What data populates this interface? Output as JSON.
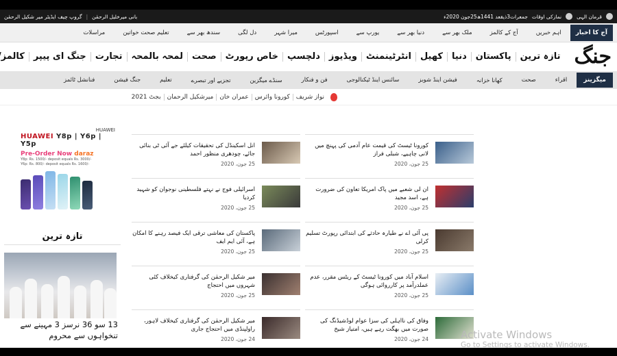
{
  "topbar": {
    "right": [
      "قرمان الہی",
      "نمازکی اوقات",
      "جمعرات3ذیقعد 1441ھ25جون 2020ء"
    ],
    "left": [
      "بانی میرخلیل الرحمٰن",
      "گروپ چیف ایڈیٹر میر شکیل الرحمٰن"
    ]
  },
  "secnav": {
    "active": "آج کا اخبار",
    "items": [
      "اہم خبریں",
      "آج کے کالمز",
      "ملک بھر سے",
      "دنیا بھر سے",
      "یورپ سے",
      "اسپورٹس",
      "میرا شہر",
      "دل لگی",
      "سندھ بھر سے",
      "تعلیم صحت خواتین",
      "مراسلات"
    ]
  },
  "logo": "جنگ",
  "mainnav": [
    "تازہ ترین",
    "پاکستان",
    "دنیا",
    "کھیل",
    "انٹرٹینمنٹ",
    "ویڈیوز",
    "دلچسپ",
    "خاص رپورٹ",
    "صحت",
    "لمحہ بالمحہ",
    "تجارت",
    "جنگ ای پیپر",
    "کالمز/کالم"
  ],
  "magbar": {
    "active": "میگزینز",
    "items": [
      "اقراء",
      "صحت",
      "کھانا خزانہ",
      "فیشن اینڈ شوبز",
      "سائنس اینڈ ٹیکنالوجی",
      "فن و فنکار",
      "سنڈے میگزین",
      "تجزیے اور تبصرے",
      "تعلیم",
      "جنگ فیشن",
      "فنانشل ٹائمز"
    ]
  },
  "trending": [
    "نواز شریف",
    "کورونا وائرس",
    "عمران خان",
    "میرشکیل الرحمان",
    "بجٹ 2021"
  ],
  "ad": {
    "brand": "HUAWEI",
    "model_prefix": "HUAWEI ",
    "model": "Y8p | Y6p | Y5p",
    "preorder": "Pre-Order Now",
    "store": "daraz",
    "line1": "Y8p: Rs. 1500/- deposit equals Rs. 3000/-",
    "line2": "Y6p: Rs. 800/- deposit equals Rs. 1600/-"
  },
  "latest": {
    "heading": "تازہ ترین",
    "title": "13 سو 36 نرسز 3 مہینے سے تنخواہوں سے محروم"
  },
  "news": [
    {
      "title": "کورونا ٹیسٹ کی قیمت عام آدمی کی پہنچ میں لانی چاہیے، شبلی فراز",
      "date": "25 جون، 2020"
    },
    {
      "title": "انل اسکینڈل کی تحقیقات کیلئے جے آئی ٹی بنائی جائے، چودھری منظور احمد",
      "date": "25 جون، 2020"
    },
    {
      "title": "ان لی شعبے میں پاک امریکا تعاون کی ضرورت ہے، اسد مجید",
      "date": "25 جون، 2020"
    },
    {
      "title": "اسرائیلی فوج نے نہتے فلسطینی نوجوان کو شہید کردیا",
      "date": "25 جون، 2020"
    },
    {
      "title": "پی آئی اے نے طیارہ حادثے کی ابتدائی رپورٹ تسلیم کرلی",
      "date": "25 جون، 2020"
    },
    {
      "title": "پاکستان کی معاشی ترقی ایک فیصد رہنے کا امکان ہے، آئی ایم ایف",
      "date": "25 جون، 2020"
    },
    {
      "title": "اسلام آباد میں کورونا ٹیسٹ کے ریٹس مقرر، عدم عملدرآمد پر کارروائی ہوگی",
      "date": "25 جون، 2020"
    },
    {
      "title": "میر شکیل الرحمٰن کی گرفتاری کیخلاف کئی شہروں میں احتجاج",
      "date": "25 جون، 2020"
    },
    {
      "title": "وفاق کی نااہلی کی سزا عوام لوڈشیڈنگ کی صورت میں بھگت رہے ہیں، امتیاز شیخ",
      "date": "24 جون، 2020"
    },
    {
      "title": "میر شکیل الرحمٰن کی گرفتاری کیخلاف لاہور، راولپنڈی میں احتجاج جاری",
      "date": "24 جون، 2020"
    }
  ],
  "watermark": {
    "line1": "Activate Windows",
    "line2": "Go to Settings to activate Windows."
  }
}
